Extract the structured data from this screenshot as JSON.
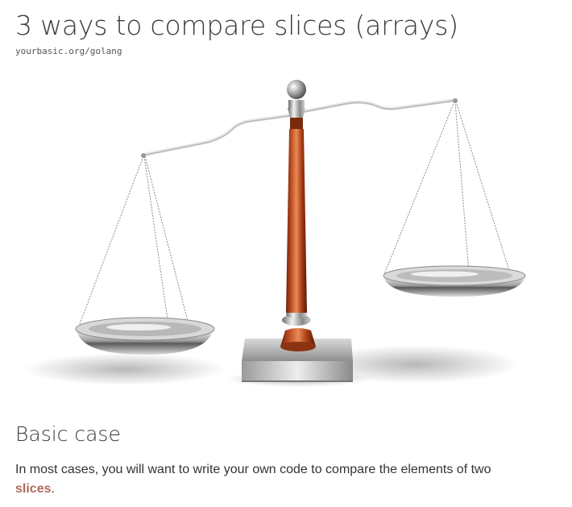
{
  "header": {
    "title": "3 ways to compare slices (arrays)",
    "site": "yourbasic.org/golang"
  },
  "hero": {
    "image_subject": "balance-scale"
  },
  "section": {
    "heading": "Basic case",
    "paragraph_before": "In most cases, you will want to write your own code to compare the elements of two ",
    "link_text": "slices",
    "paragraph_after": "."
  },
  "colors": {
    "link": "#b06a5c",
    "text": "#333333",
    "pillar": "#b5461f"
  }
}
